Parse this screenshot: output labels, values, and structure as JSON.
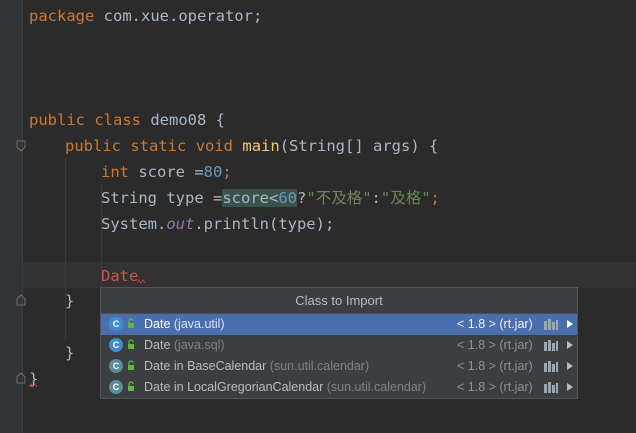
{
  "editor": {
    "lines": {
      "l1": {
        "kw": "package",
        "rest": " com.xue.operator;"
      },
      "l5": {
        "kw1": "public",
        "kw2": "class",
        "rest": " demo08 {"
      },
      "l6": {
        "kw1": "public",
        "kw2": "static",
        "kw3": "void",
        "method": "main",
        "rest": "(String[] args) {"
      },
      "l7": {
        "kw": "int",
        "rest": " score =",
        "num": "80",
        "semi": ";"
      },
      "l8": {
        "pre": "String type =",
        "hl": "score",
        "op": "<",
        "num": "60",
        "q": "?",
        "s1": "\"不及格\"",
        "colon": ":",
        "s2": "\"及格\"",
        "semi": ";"
      },
      "l9": {
        "pre": "System.",
        "field": "out",
        "rest": ".println(type);"
      },
      "l11": {
        "err": "Date"
      },
      "l12": {
        "text": "}"
      },
      "l14": {
        "text": "}"
      },
      "l15": {
        "text": "}"
      }
    }
  },
  "popup": {
    "title": "Class to Import",
    "items": [
      {
        "class": "Date",
        "package": "(java.util)",
        "version": "< 1.8 > (rt.jar)"
      },
      {
        "class": "Date",
        "package": "(java.sql)",
        "version": "< 1.8 > (rt.jar)"
      },
      {
        "class": "Date in BaseCalendar",
        "package": "(sun.util.calendar)",
        "version": "< 1.8 > (rt.jar)"
      },
      {
        "class": "Date in LocalGregorianCalendar",
        "package": "(sun.util.calendar)",
        "version": "< 1.8 > (rt.jar)"
      }
    ]
  },
  "colors": {
    "background": "#2b2b2b",
    "keyword": "#cc7832",
    "number": "#6897bb",
    "string": "#6a8759",
    "method": "#ffc66d",
    "error": "#d25252",
    "selection": "#4b6eaf"
  }
}
